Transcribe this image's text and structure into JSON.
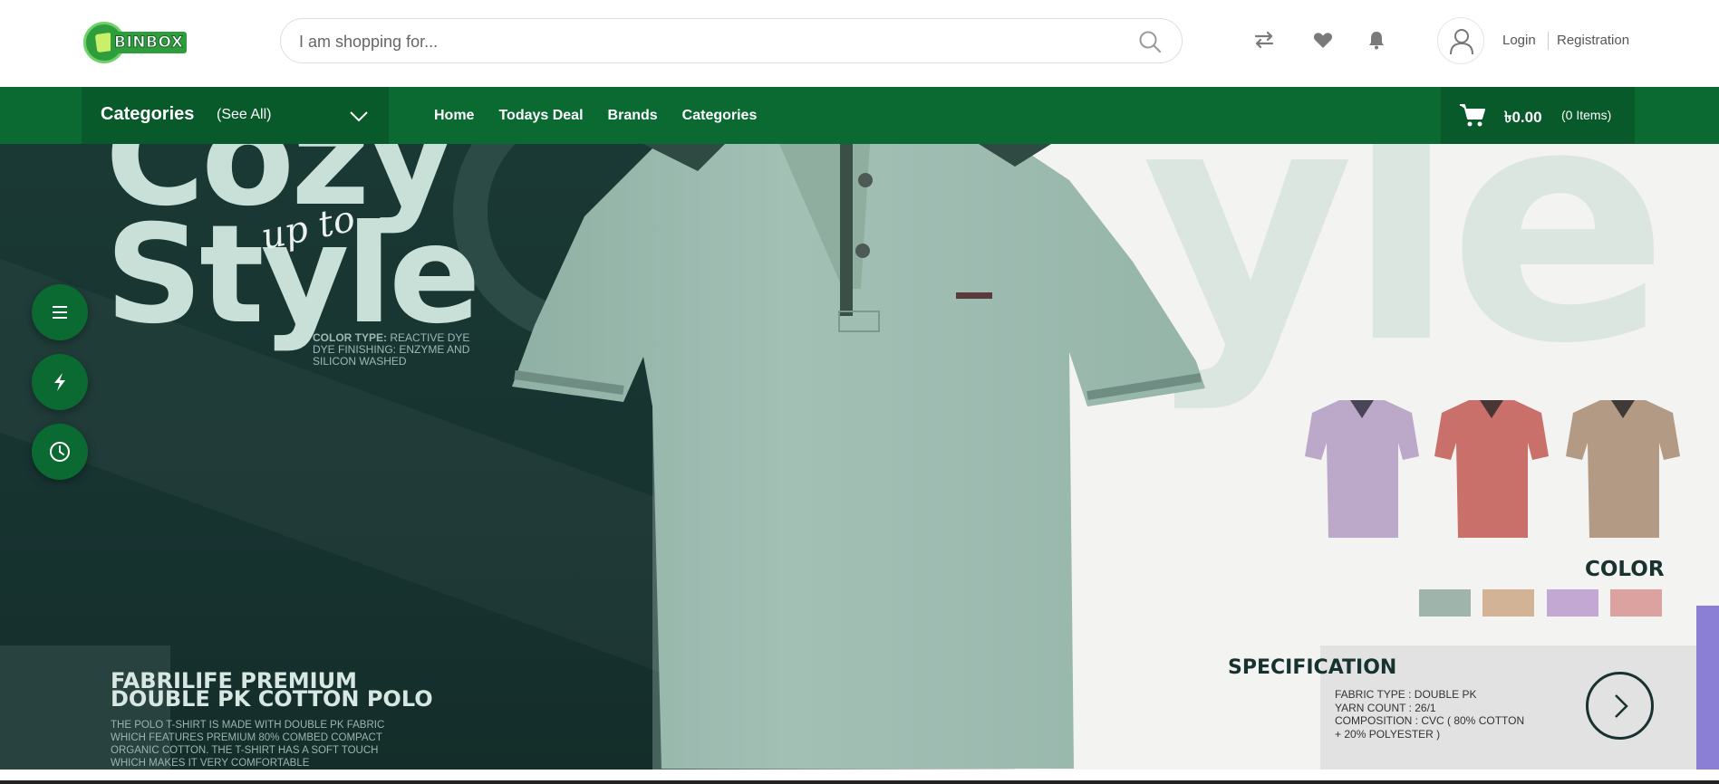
{
  "header": {
    "logo_text": "BINBOX",
    "search_placeholder": "I am shopping for...",
    "login_label": "Login",
    "registration_label": "Registration"
  },
  "nav": {
    "categories_title": "Categories",
    "see_all": "(See All)",
    "links": [
      "Home",
      "Todays Deal",
      "Brands",
      "Categories"
    ],
    "cart_amount": "৳0.00",
    "cart_items": "(0 Items)"
  },
  "banner": {
    "headline_top": "Cozy",
    "headline_bottom": "Style",
    "script_text": "up to",
    "background_text": "yle",
    "color_type_label": "COLOR TYPE:",
    "color_type_text": "REACTIVE DYE DYE FINISHING: ENZYME AND SILICON WASHED",
    "product_title_line1": "FABRILIFE PREMIUM",
    "product_title_line2": "DOUBLE PK COTTON POLO",
    "product_description": "THE POLO T-SHIRT IS MADE WITH DOUBLE PK FABRIC WHICH FEATURES PREMIUM 80% COMBED COMPACT ORGANIC COTTON. THE T-SHIRT HAS A SOFT TOUCH WHICH MAKES IT VERY COMFORTABLE",
    "color_title": "COLOR",
    "spec_title": "SPECIFICATION",
    "spec_lines": [
      "FABRIC TYPE  :  DOUBLE PK",
      "YARN COUNT   :  26/1",
      "COMPOSITION : CVC ( 80% COTTON",
      "+ 20% POLYESTER )"
    ],
    "swatch_colors": [
      "#9fb5ab",
      "#d2b396",
      "#c3a8d3",
      "#dca2a0"
    ],
    "mini_shirt_colors": [
      "#bca8c9",
      "#c9706a",
      "#b39a84"
    ],
    "main_shirt_color": "#9fbcb0"
  },
  "quick_buttons": [
    "menu-icon",
    "flash-icon",
    "clock-icon"
  ],
  "colors": {
    "brand_green": "#0b6a32",
    "brand_green_dark": "#085a2a"
  }
}
